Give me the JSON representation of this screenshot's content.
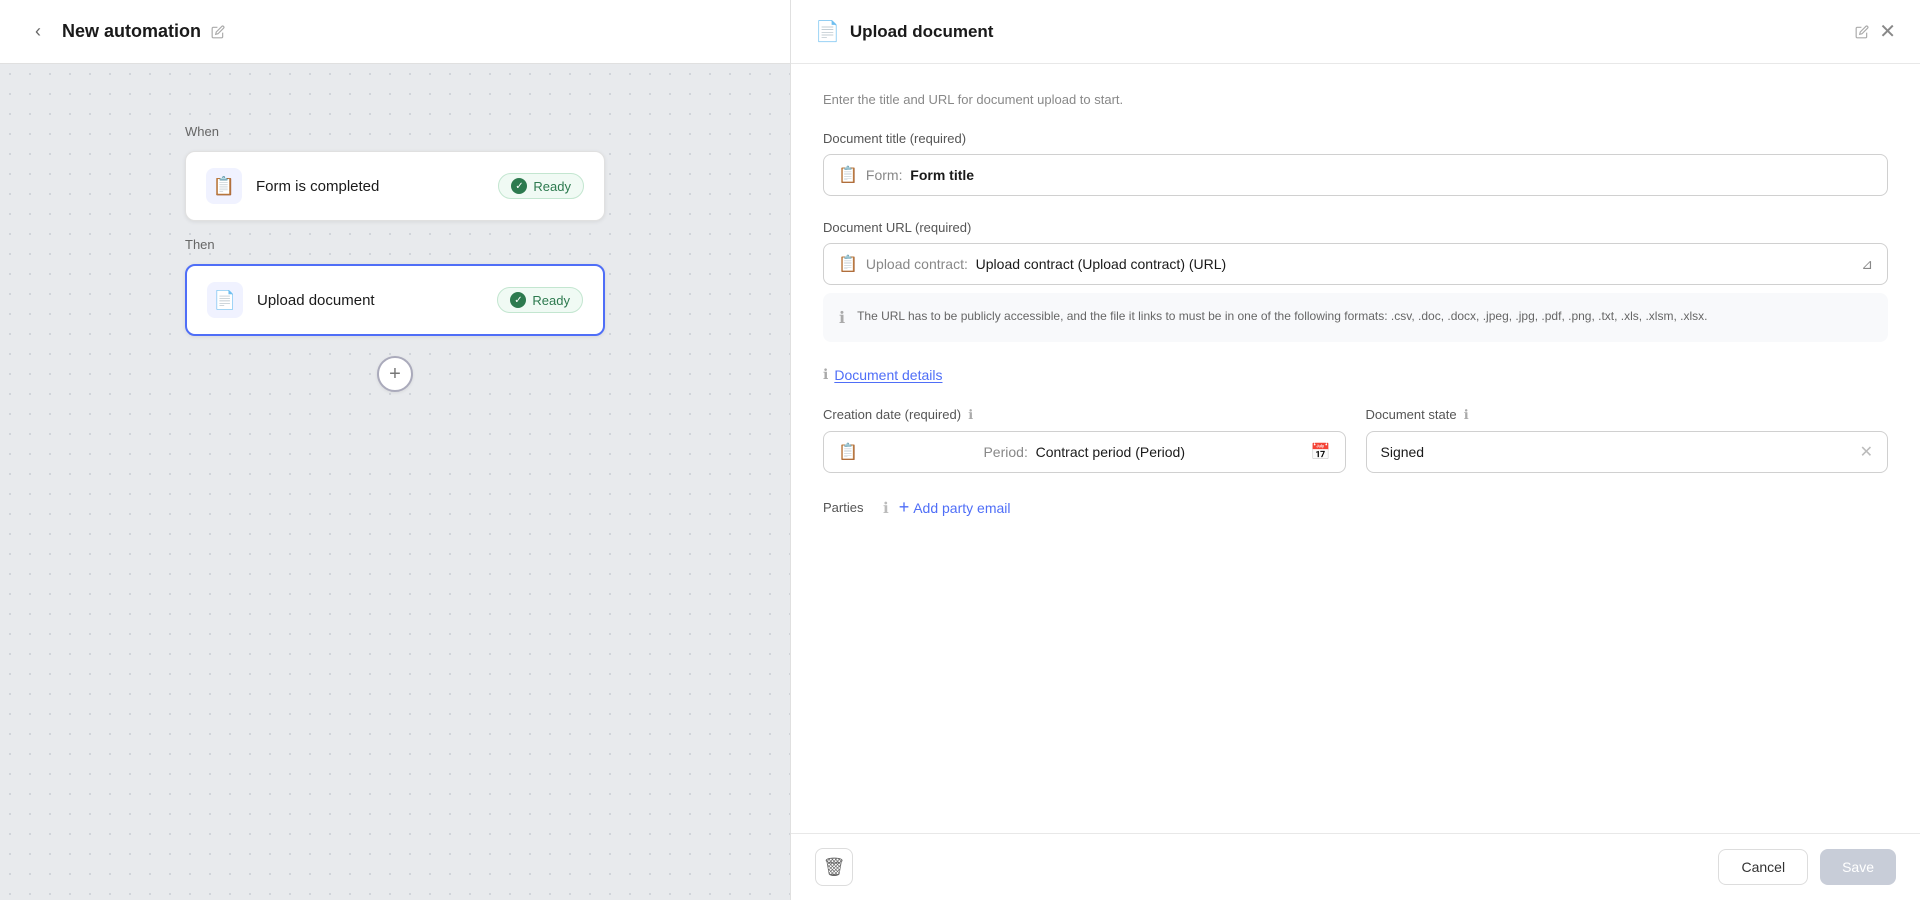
{
  "header": {
    "title": "New automation",
    "back_label": "←",
    "edit_icon": "✏️"
  },
  "left": {
    "when_label": "When",
    "then_label": "Then",
    "trigger_card": {
      "icon": "📋",
      "title": "Form is completed",
      "badge": "Ready"
    },
    "action_card": {
      "icon": "📄",
      "title": "Upload document",
      "badge": "Ready"
    },
    "add_btn": "+"
  },
  "right": {
    "header": {
      "icon": "📄",
      "title": "Upload document",
      "edit_icon": "✏️",
      "close_icon": "✕"
    },
    "subtitle": "Enter the title and URL for document upload to start.",
    "document_title_label": "Document title (required)",
    "document_title_value": "Form: Form title",
    "document_title_prefix": "Form:",
    "document_title_field": "Form title",
    "document_url_label": "Document URL (required)",
    "document_url_prefix": "Upload contract:",
    "document_url_value": "Upload contract (Upload contract) (URL)",
    "info_text": "The URL has to be publicly accessible, and the file it links to must be in one of the following formats: .csv, .doc, .docx, .jpeg, .jpg, .pdf, .png, .txt, .xls, .xlsm, .xlsx.",
    "document_details_label": "Document details",
    "creation_date_label": "Creation date (required)",
    "creation_date_value": "Period: Contract period (Period)",
    "creation_date_prefix": "Period:",
    "creation_date_field": "Contract period (Period)",
    "document_state_label": "Document state",
    "document_state_value": "Signed",
    "parties_label": "Parties",
    "add_party_label": "Add party email",
    "cancel_btn": "Cancel",
    "save_btn": "Save"
  }
}
